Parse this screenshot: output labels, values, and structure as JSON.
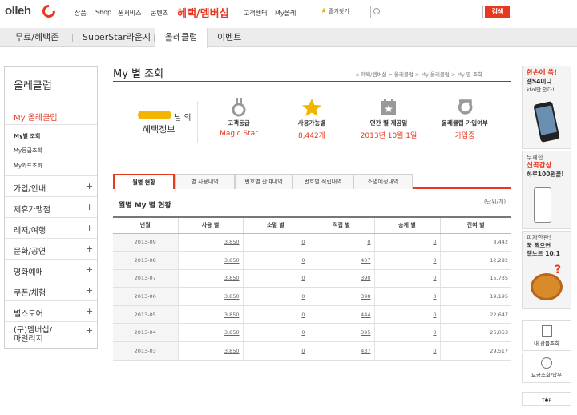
{
  "header": {
    "logo": "olleh",
    "gnav": [
      "상품",
      "Shop",
      "폰서비스",
      "콘텐츠"
    ],
    "gnav_highlight": "혜택/멤버십",
    "gnav_right": [
      "고객센터",
      "My올레"
    ],
    "favorite": "즐겨찾기",
    "search_placeholder": "",
    "search_button": "검색"
  },
  "subnav": [
    "무료/혜택존",
    "SuperStar라운지",
    "올레클럽",
    "이벤트"
  ],
  "subnav_active": "올레클럽",
  "sidebar": {
    "title": "올레클럽",
    "sections": [
      {
        "label": "My 올레클럽",
        "toggle": "−",
        "active": true,
        "items": [
          "My별 조회",
          "My등급조회",
          "My카드조회"
        ]
      },
      {
        "label": "가입/안내",
        "toggle": "+"
      },
      {
        "label": "제휴가맹점",
        "toggle": "+"
      },
      {
        "label": "레저/여행",
        "toggle": "+"
      },
      {
        "label": "문화/공연",
        "toggle": "+"
      },
      {
        "label": "영화예매",
        "toggle": "+"
      },
      {
        "label": "쿠폰/체험",
        "toggle": "+"
      },
      {
        "label": "별스토어",
        "toggle": "+"
      },
      {
        "label": "(구)멤버십/\n마일리지",
        "toggle": "+"
      }
    ]
  },
  "main": {
    "page_title": "My 별 조회",
    "breadcrumb": "혜택/멤버십 > 올레클럽 > My 올레클럽 > My 별 조회",
    "user": {
      "suffix": "님 의",
      "benefit": "혜택정보"
    },
    "info": [
      {
        "label": "고객등급",
        "value": "Magic Star",
        "icon": "medal-icon"
      },
      {
        "label": "사용가능별",
        "value": "8,442개",
        "icon": "star-icon"
      },
      {
        "label": "연간 별 제공일",
        "value": "2013년 10월 1일",
        "icon": "calendar-icon"
      },
      {
        "label": "올레클럽 가입여부",
        "value": "가입중",
        "icon": "olleh-logo-icon"
      }
    ],
    "tabs": [
      "월별 현황",
      "별 사용내역",
      "번호별 잔여내역",
      "번호별 적립내역",
      "소멸예정내역"
    ],
    "section_title": "월별 My 별 현황",
    "unit": "(단위/개)",
    "table": {
      "headers": [
        "년월",
        "사용 별",
        "소멸 별",
        "적립 별",
        "승계 별",
        "잔여 별"
      ],
      "rows": [
        [
          "2013-09",
          "3,850",
          "0",
          "0",
          "0",
          "8,442"
        ],
        [
          "2013-08",
          "3,850",
          "0",
          "407",
          "0",
          "12,292"
        ],
        [
          "2013-07",
          "3,850",
          "0",
          "390",
          "0",
          "15,735"
        ],
        [
          "2013-06",
          "3,850",
          "0",
          "398",
          "0",
          "19,195"
        ],
        [
          "2013-05",
          "3,850",
          "0",
          "444",
          "0",
          "22,647"
        ],
        [
          "2013-04",
          "3,850",
          "0",
          "395",
          "0",
          "26,053"
        ],
        [
          "2013-03",
          "3,850",
          "0",
          "437",
          "0",
          "29,517"
        ]
      ]
    }
  },
  "right": {
    "ad1": {
      "l1": "한손에 쏙!",
      "l2": "갤S4미니",
      "l3": "ktol만 있다!"
    },
    "ad2": {
      "l1": "무제한",
      "l2": "신곡감상",
      "l3": "하루100원꼴!"
    },
    "ad3": {
      "l1": "피자한판!",
      "l2": "꾹 찍으면",
      "l3": "갤노트 10.1"
    },
    "links": [
      "내 상품조회",
      "요금조회/납부"
    ],
    "top": "TOP"
  },
  "colors": {
    "accent": "#e8381f",
    "star": "#f2b600"
  }
}
